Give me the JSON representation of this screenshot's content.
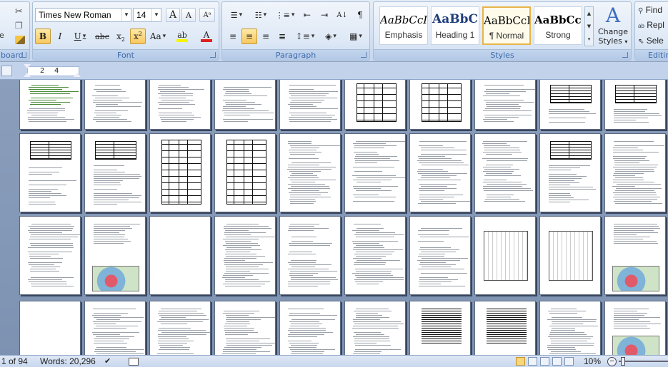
{
  "clipboard": {
    "label": "board"
  },
  "font": {
    "label": "Font",
    "family": "Times New Roman",
    "size": "14",
    "grow_label": "A",
    "shrink_label": "A",
    "bold": "B",
    "italic": "I",
    "underline": "U",
    "strike": "abc",
    "subscript": "x",
    "superscript": "x",
    "change_case": "Aa",
    "font_color": "A",
    "highlight": "ab"
  },
  "paragraph": {
    "label": "Paragraph"
  },
  "styles": {
    "label": "Styles",
    "items": [
      {
        "preview": "AaBbCcI",
        "name": "Emphasis"
      },
      {
        "preview": "AaBbC",
        "name": "Heading 1"
      },
      {
        "preview": "AaBbCcI",
        "name": "¶ Normal"
      },
      {
        "preview": "AaBbCcI",
        "name": "Strong"
      }
    ],
    "change_label_1": "Change",
    "change_label_2": "Styles"
  },
  "editing": {
    "label": "Editin",
    "find": "Find",
    "replace": "Repl",
    "select": "Sele"
  },
  "ruler": {
    "marks": [
      "2",
      "4"
    ]
  },
  "status": {
    "page": "1 of 94",
    "words": "Words: 20,296",
    "zoom": "10%"
  },
  "colors": {
    "ribbon": "#dbe6f4",
    "canvas": "#8a9dba",
    "highlight": "#f8c860",
    "font_color": "#e02020",
    "highlight_color": "#f5f500"
  }
}
